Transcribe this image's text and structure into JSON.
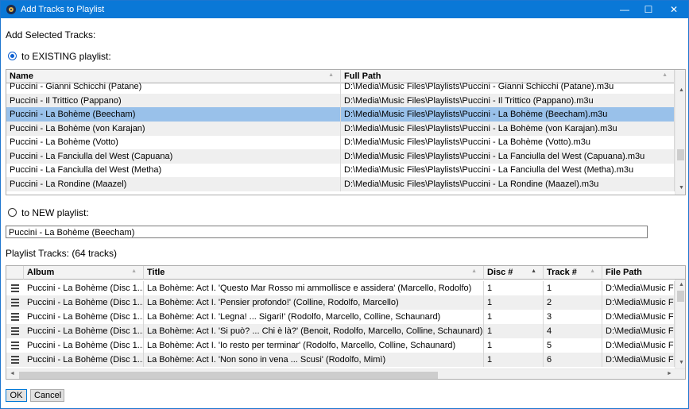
{
  "window": {
    "title": "Add Tracks to Playlist",
    "minimize": "—",
    "maximize": "☐",
    "close": "✕"
  },
  "add_selected_label": "Add Selected Tracks:",
  "existing": {
    "radio_label": "to EXISTING playlist:",
    "columns": [
      "Name",
      "Full Path"
    ],
    "rows": [
      {
        "name": "Puccini - Gianni Schicchi (Patane)",
        "path": "D:\\Media\\Music Files\\Playlists\\Puccini - Gianni Schicchi (Patane).m3u"
      },
      {
        "name": "Puccini - Il Trittico (Pappano)",
        "path": "D:\\Media\\Music Files\\Playlists\\Puccini - Il Trittico (Pappano).m3u"
      },
      {
        "name": "Puccini - La Bohème (Beecham)",
        "path": "D:\\Media\\Music Files\\Playlists\\Puccini - La Bohème (Beecham).m3u"
      },
      {
        "name": "Puccini - La Bohème (von Karajan)",
        "path": "D:\\Media\\Music Files\\Playlists\\Puccini - La Bohème (von Karajan).m3u"
      },
      {
        "name": "Puccini - La Bohème (Votto)",
        "path": "D:\\Media\\Music Files\\Playlists\\Puccini - La Bohème (Votto).m3u"
      },
      {
        "name": "Puccini - La Fanciulla del West (Capuana)",
        "path": "D:\\Media\\Music Files\\Playlists\\Puccini - La Fanciulla del West (Capuana).m3u"
      },
      {
        "name": "Puccini - La Fanciulla del West (Metha)",
        "path": "D:\\Media\\Music Files\\Playlists\\Puccini - La Fanciulla del West (Metha).m3u"
      },
      {
        "name": "Puccini - La Rondine (Maazel)",
        "path": "D:\\Media\\Music Files\\Playlists\\Puccini - La Rondine (Maazel).m3u"
      }
    ],
    "selected_index": 2
  },
  "new": {
    "radio_label": "to NEW playlist:",
    "name_value": "Puccini - La Bohème (Beecham)"
  },
  "tracks": {
    "label": "Playlist Tracks: (64 tracks)",
    "columns": [
      "Album",
      "Title",
      "Disc #",
      "Track #",
      "File Path"
    ],
    "rows": [
      {
        "album": "Puccini - La Bohème (Disc 1...",
        "title": "La Bohème: Act I. 'Questo Mar Rosso mi ammollisce e assidera' (Marcello, Rodolfo)",
        "disc": "1",
        "track": "1",
        "file": "D:\\Media\\Music Fil"
      },
      {
        "album": "Puccini - La Bohème (Disc 1...",
        "title": "La Bohème: Act I. 'Pensier profondo!' (Colline, Rodolfo, Marcello)",
        "disc": "1",
        "track": "2",
        "file": "D:\\Media\\Music Fil"
      },
      {
        "album": "Puccini - La Bohème (Disc 1...",
        "title": "La Bohème: Act I. 'Legna! ... Sigari!' (Rodolfo, Marcello, Colline, Schaunard)",
        "disc": "1",
        "track": "3",
        "file": "D:\\Media\\Music Fil"
      },
      {
        "album": "Puccini - La Bohème (Disc 1...",
        "title": "La Bohème: Act I. 'Si può? ... Chi è là?' (Benoit, Rodolfo, Marcello, Colline, Schaunard)",
        "disc": "1",
        "track": "4",
        "file": "D:\\Media\\Music Fil"
      },
      {
        "album": "Puccini - La Bohème (Disc 1...",
        "title": "La Bohème: Act I. 'Io resto per terminar' (Rodolfo, Marcello, Colline, Schaunard)",
        "disc": "1",
        "track": "5",
        "file": "D:\\Media\\Music Fil"
      },
      {
        "album": "Puccini - La Bohème (Disc 1...",
        "title": "La Bohème: Act I. 'Non sono in vena ... Scusi' (Rodolfo, Mimì)",
        "disc": "1",
        "track": "6",
        "file": "D:\\Media\\Music Fil"
      }
    ]
  },
  "buttons": {
    "ok": "OK",
    "cancel": "Cancel"
  }
}
